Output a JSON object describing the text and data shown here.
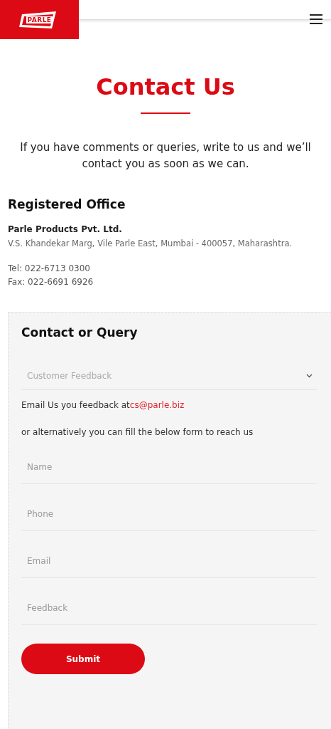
{
  "header": {
    "logo_text": "PARLE"
  },
  "title": "Contact Us",
  "intro": "If you have comments or queries, write to us and we’ll contact you as soon as we can.",
  "office": {
    "heading": "Registered Office",
    "company": "Parle Products Pvt. Ltd.",
    "address": "V.S. Khandekar Marg, Vile Parle East, Mumbai - 400057, Maharashtra.",
    "tel": "Tel: 022-6713 0300",
    "fax": "Fax: 022-6691 6926"
  },
  "form": {
    "heading": "Contact or Query",
    "select": {
      "value": "Customer Feedback"
    },
    "email_text": "Email Us you feedback at",
    "email_link": "cs@parle.biz",
    "alt_text": "or alternatively you can fill the below form to reach us",
    "fields": [
      {
        "placeholder": "Name"
      },
      {
        "placeholder": "Phone"
      },
      {
        "placeholder": "Email"
      },
      {
        "placeholder": "Feedback"
      }
    ],
    "submit": "Submit"
  }
}
